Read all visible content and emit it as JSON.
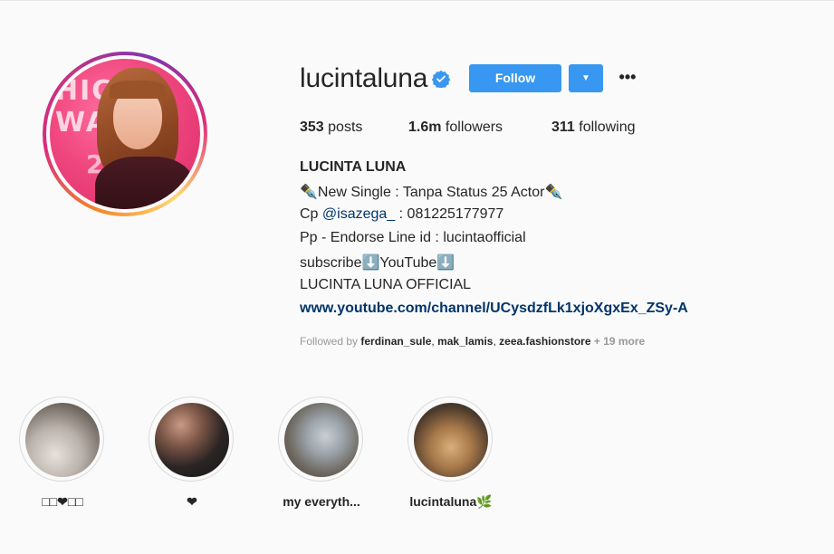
{
  "profile": {
    "username": "lucintaluna",
    "verified_icon": "verified-badge-icon",
    "follow_label": "Follow",
    "dropdown_glyph": "▼",
    "more_glyph": "•••",
    "accent_color": "#3897f0"
  },
  "stats": {
    "posts_count": "353",
    "posts_label": "posts",
    "followers_count": "1.6m",
    "followers_label": "followers",
    "following_count": "311",
    "following_label": "following"
  },
  "bio": {
    "name": "LUCINTA LUNA",
    "line1": "✒️New Single : Tanpa Status 25 Actor✒️",
    "line2_prefix": "Cp ",
    "line2_mention": "@isazega_",
    "line2_suffix": " : 081225177977",
    "line3": "Pp - Endorse Line id : lucintaofficial",
    "line4": "subscribe⬇️YouTube⬇️",
    "line5": "LUCINTA LUNA OFFICIAL",
    "link": "www.youtube.com/channel/UCysdzfLk1xjoXgxEx_ZSy-A"
  },
  "followed_by": {
    "prefix": "Followed by ",
    "users": [
      "ferdinan_sule",
      "mak_lamis",
      "zeea.fashionstore"
    ],
    "more": " + 19 more"
  },
  "highlights": [
    {
      "label": "□□❤□□"
    },
    {
      "label": "❤"
    },
    {
      "label": "my everyth..."
    },
    {
      "label": "lucintaluna🌿"
    }
  ]
}
